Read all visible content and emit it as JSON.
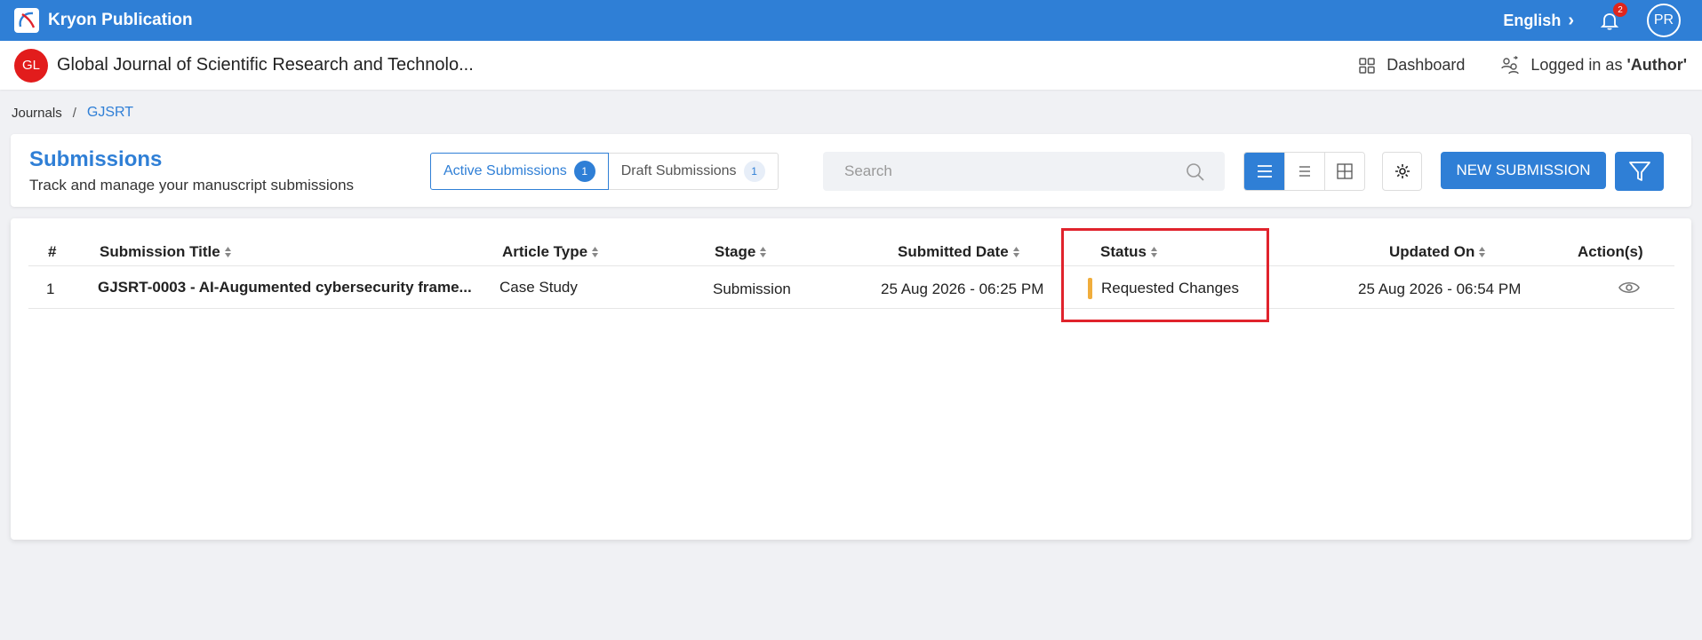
{
  "app": {
    "name": "Kryon Publication",
    "language": "English",
    "notification_count": "2",
    "user_initials": "PR"
  },
  "journal": {
    "logo_initials": "GL",
    "title": "Global Journal of Scientific Research and Technolo...",
    "dashboard_label": "Dashboard",
    "logged_in_prefix": "Logged in as ",
    "logged_in_role": "'Author'"
  },
  "breadcrumb": {
    "root": "Journals",
    "separator": "/",
    "current": "GJSRT"
  },
  "submissions": {
    "title": "Submissions",
    "subtitle": "Track and manage your manuscript submissions",
    "tabs": [
      {
        "label": "Active Submissions",
        "count": "1"
      },
      {
        "label": "Draft Submissions",
        "count": "1"
      }
    ],
    "search_placeholder": "Search",
    "new_button_label": "NEW SUBMISSION"
  },
  "table": {
    "columns": {
      "num": "#",
      "title": "Submission Title",
      "article_type": "Article Type",
      "stage": "Stage",
      "submitted": "Submitted Date",
      "status": "Status",
      "updated": "Updated On",
      "actions": "Action(s)"
    },
    "rows": [
      {
        "num": "1",
        "title": "GJSRT-0003 - AI-Augumented cybersecurity frame...",
        "article_type": "Case Study",
        "stage": "Submission",
        "submitted": "25 Aug 2026 - 06:25 PM",
        "status": "Requested Changes",
        "updated": "25 Aug 2026 - 06:54 PM"
      }
    ]
  },
  "colors": {
    "primary": "#2f7fd6",
    "status_warning": "#f0ad3c",
    "highlight": "#e0232c",
    "journal_logo": "#e21c1c"
  }
}
